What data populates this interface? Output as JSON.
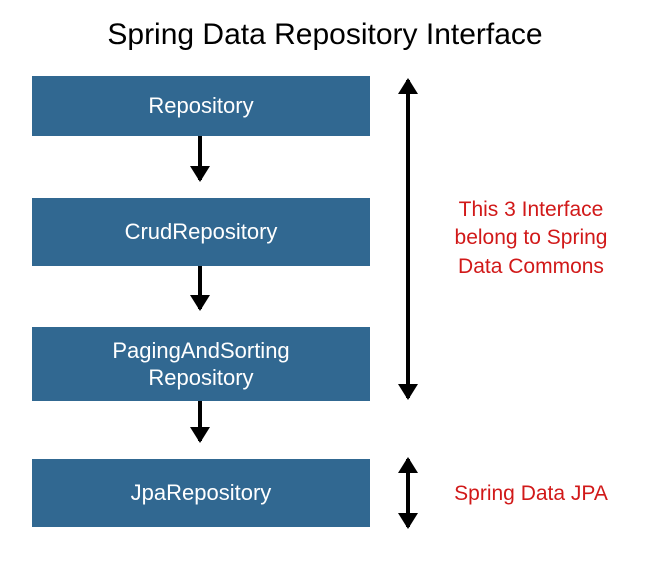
{
  "title": "Spring Data Repository Interface",
  "boxes": [
    {
      "label": "Repository"
    },
    {
      "label": "CrudRepository"
    },
    {
      "label": "PagingAndSorting\nRepository"
    },
    {
      "label": "JpaRepository"
    }
  ],
  "annotations": {
    "commons": "This 3 Interface\nbelong to Spring\nData Commons",
    "jpa": "Spring Data JPA"
  },
  "colors": {
    "box_bg": "#316891",
    "box_text": "#ffffff",
    "annotation": "#d11919"
  }
}
